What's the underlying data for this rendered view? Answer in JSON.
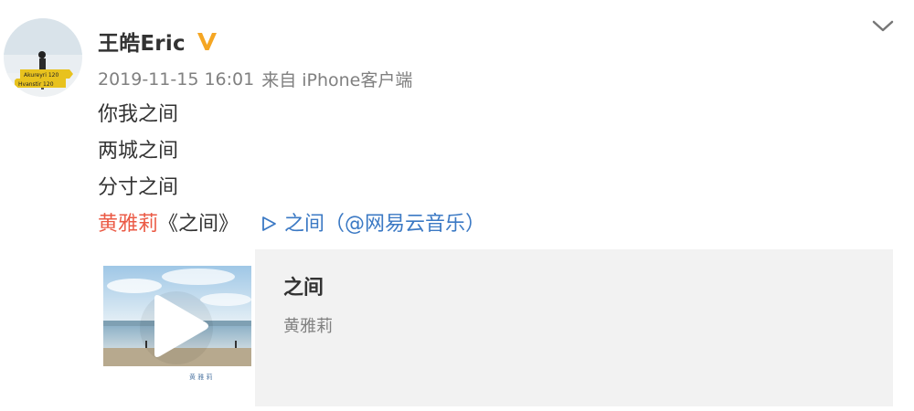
{
  "author": {
    "name": "王皓Eric",
    "verified_icon": "verified-v-icon",
    "verified_color": "#f5a623"
  },
  "meta": {
    "time": "2019-11-15 16:01",
    "from_label": "来自",
    "source": "iPhone客户端"
  },
  "content": {
    "lines": [
      "你我之间",
      "两城之间",
      "分寸之间"
    ],
    "artist_link": "黄雅莉",
    "song_title": "《之间》",
    "play_icon": "play-triangle-icon",
    "play_link": "之间（@网易云音乐）"
  },
  "music_card": {
    "title": "之间",
    "artist": "黄雅莉",
    "cover_text": "黄 雅 莉",
    "play_overlay_icon": "play-icon"
  },
  "colors": {
    "artist_link": "#eb5a45",
    "play_link": "#3b79c4",
    "meta_text": "#808080",
    "card_bg": "#f2f2f2"
  },
  "icons": {
    "menu": "chevron-down-icon",
    "avatar": "avatar"
  }
}
